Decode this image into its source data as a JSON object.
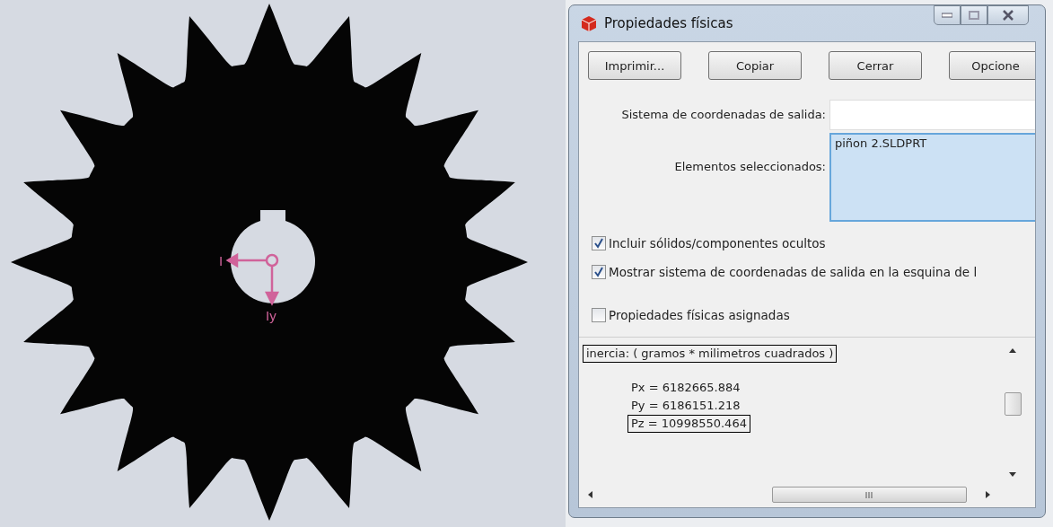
{
  "cad_view": {
    "axis_labels": [
      "I",
      "Iy"
    ]
  },
  "window": {
    "title": "Propiedades físicas",
    "buttons": [
      "Imprimir...",
      "Copiar",
      "Cerrar",
      "Opcione"
    ],
    "output_coordinate_system": {
      "label": "Sistema de coordenadas de salida:"
    },
    "selected_elements": {
      "label": "Elementos seleccionados:",
      "items": [
        "piñon 2.SLDPRT"
      ]
    },
    "options": [
      {
        "label": "Incluir sólidos/componentes ocultos",
        "checked": true
      },
      {
        "label": "Mostrar sistema de coordenadas de salida en la esquina de l",
        "checked": true
      },
      {
        "label": "Propiedades físicas asignadas",
        "checked": false
      }
    ],
    "results": {
      "lines": [
        {
          "text": "inercia: ( gramos *  milimetros cuadrados )",
          "kind": "heading",
          "boxed": true
        },
        {
          "text": "Px = 6182665.884",
          "kind": "value",
          "boxed": false
        },
        {
          "text": "Py = 6186151.218",
          "kind": "value",
          "boxed": false
        },
        {
          "text": "Pz = 10998550.464",
          "kind": "value",
          "boxed": true
        }
      ]
    }
  }
}
